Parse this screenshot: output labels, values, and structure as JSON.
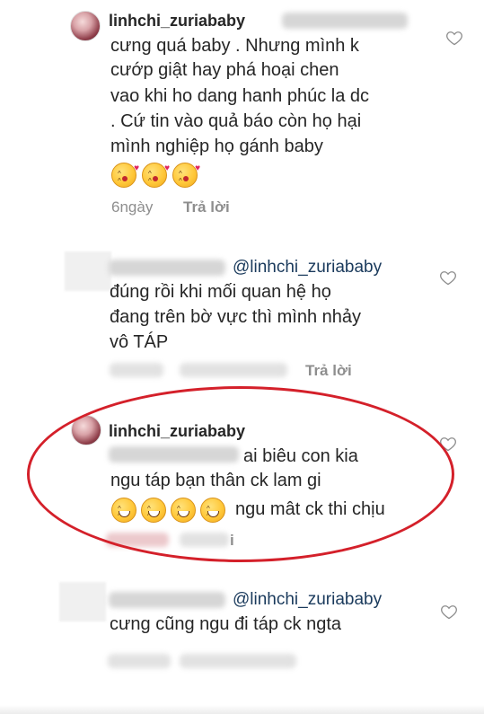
{
  "comments": [
    {
      "username": "linhchi_zuriababy",
      "lines": [
        "cưng quá baby . Nhưng mình k",
        "cướp giật hay phá hoại chen",
        "vao khi ho dang hanh phúc la dc",
        ". Cứ tin vào quả báo còn họ hại",
        "mình nghiệp họ gánh baby"
      ],
      "emoji_count": 3,
      "time": "6ngày",
      "reply_label": "Trả lời"
    },
    {
      "mention": "@linhchi_zuriababy",
      "lines": [
        "đúng rồi khi mối quan hệ họ",
        "đang trên bờ vực thì mình nhảy",
        "vô TÁP"
      ],
      "reply_label": "Trả lời"
    },
    {
      "username": "linhchi_zuriababy",
      "lines": [
        "ai biêu con kia",
        "ngu táp bạn thân ck lam gi"
      ],
      "after_emoji_text": "ngu mât ck thi chịu",
      "emoji_count": 4,
      "reply_partial": "i"
    },
    {
      "mention": "@linhchi_zuriababy",
      "lines": [
        "cưng cũng ngu đi táp ck ngta"
      ]
    }
  ],
  "icons": {
    "like": "heart-outline-icon"
  },
  "colors": {
    "highlight": "#d4202a",
    "mention": "#1a3a5c",
    "meta": "#8e8e8e"
  }
}
